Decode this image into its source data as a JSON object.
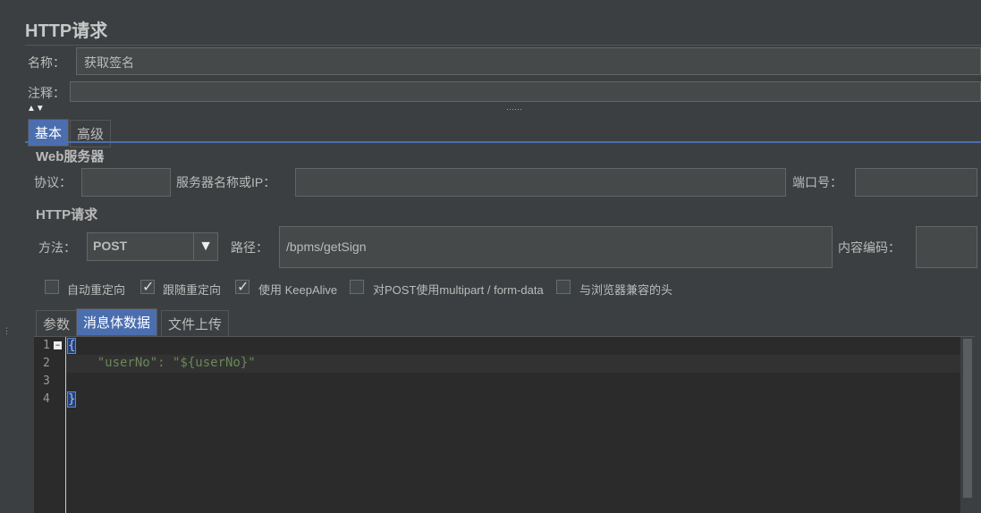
{
  "title": "HTTP请求",
  "name_label": "名称：",
  "name_value": "获取签名",
  "comment_label": "注释：",
  "tabs": [
    "基本",
    "高级"
  ],
  "web_server": "Web服务器",
  "protocol_label": "协议：",
  "server_label": "服务器名称或IP：",
  "port_label": "端口号：",
  "http_request": "HTTP请求",
  "method_label": "方法：",
  "method_value": "POST",
  "path_label": "路径：",
  "path_value": "/bpms/getSign",
  "encoding_label": "内容编码：",
  "options": [
    "自动重定向",
    "跟随重定向",
    "使用 KeepAlive",
    "对POST使用multipart / form-data",
    "与浏览器兼容的头"
  ],
  "option_checked": [
    false,
    true,
    true,
    false,
    false
  ],
  "body_tabs": [
    "参数",
    "消息体数据",
    "文件上传"
  ],
  "line_numbers": [
    "1",
    "2",
    "3",
    "4"
  ],
  "code_lines": [
    "{",
    "    \"userNo\": \"${userNo}\"",
    "",
    "}"
  ],
  "colors": {
    "accent": "#4b6eaf",
    "code_green": "#6a8759"
  }
}
